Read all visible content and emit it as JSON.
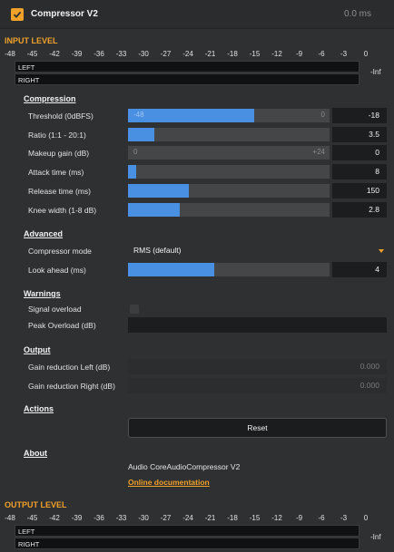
{
  "header": {
    "enabled": true,
    "title": "Compressor V2",
    "time": "0.0 ms"
  },
  "input_level": {
    "label": "INPUT LEVEL",
    "scale": [
      "-48",
      "-45",
      "-42",
      "-39",
      "-36",
      "-33",
      "-30",
      "-27",
      "-24",
      "-21",
      "-18",
      "-15",
      "-12",
      "-9",
      "-6",
      "-3",
      "0"
    ],
    "left_label": "LEFT",
    "right_label": "RIGHT",
    "peak": "-Inf"
  },
  "compression": {
    "heading": "Compression",
    "threshold": {
      "label": "Threshold (0dBFS)",
      "min": "-48",
      "max": "0",
      "value": "-18",
      "fraction": 0.625
    },
    "ratio": {
      "label": "Ratio (1:1 - 20:1)",
      "value": "3.5",
      "fraction": 0.13
    },
    "makeup": {
      "label": "Makeup gain (dB)",
      "min": "0",
      "max": "+24",
      "value": "0",
      "fraction": 0
    },
    "attack": {
      "label": "Attack time (ms)",
      "value": "8",
      "fraction": 0.04
    },
    "release": {
      "label": "Release time (ms)",
      "value": "150",
      "fraction": 0.3
    },
    "knee": {
      "label": "Knee width (1-8 dB)",
      "value": "2.8",
      "fraction": 0.255
    }
  },
  "advanced": {
    "heading": "Advanced",
    "mode": {
      "label": "Compressor mode",
      "value": "RMS (default)"
    },
    "lookahead": {
      "label": "Look ahead (ms)",
      "value": "4",
      "fraction": 0.43
    }
  },
  "warnings": {
    "heading": "Warnings",
    "signal_overload": "Signal overload",
    "peak_overload": "Peak Overload (dB)"
  },
  "output": {
    "heading": "Output",
    "gr_left": {
      "label": "Gain reduction Left (dB)",
      "value": "0.000"
    },
    "gr_right": {
      "label": "Gain reduction Right (dB)",
      "value": "0.000"
    }
  },
  "actions": {
    "heading": "Actions",
    "reset": "Reset"
  },
  "about": {
    "heading": "About",
    "name": "Audio CoreAudioCompressor V2",
    "link": "Online documentation"
  },
  "output_level": {
    "label": "OUTPUT LEVEL",
    "scale": [
      "-48",
      "-45",
      "-42",
      "-39",
      "-36",
      "-33",
      "-30",
      "-27",
      "-24",
      "-21",
      "-18",
      "-15",
      "-12",
      "-9",
      "-6",
      "-3",
      "0"
    ],
    "left_label": "LEFT",
    "right_label": "RIGHT",
    "peak": "-Inf"
  },
  "colors": {
    "accent": "#f0a12a",
    "slider_fill": "#4a90e2",
    "background": "#2f3032"
  }
}
